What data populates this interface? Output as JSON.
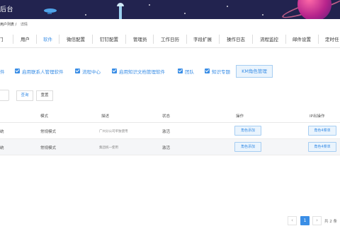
{
  "header": {
    "title": "后台",
    "colors": {
      "banner_bg": "#22234f",
      "accent": "#3a8ee6"
    }
  },
  "breadcrumb": {
    "parent": "用户列表",
    "current": "详情"
  },
  "tabs": [
    {
      "label": "门",
      "active": false
    },
    {
      "label": "用户",
      "active": false
    },
    {
      "label": "软件",
      "active": true
    },
    {
      "label": "微信配置",
      "active": false
    },
    {
      "label": "钉钉配置",
      "active": false
    },
    {
      "label": "管理员",
      "active": false
    },
    {
      "label": "工作日历",
      "active": false
    },
    {
      "label": "字段扩展",
      "active": false
    },
    {
      "label": "操作日志",
      "active": false
    },
    {
      "label": "流程监控",
      "active": false
    },
    {
      "label": "邮件设置",
      "active": false
    },
    {
      "label": "定时任",
      "active": false
    }
  ],
  "permissions": [
    {
      "label": "件",
      "checked": true,
      "show_checkbox": false
    },
    {
      "label": "启用联系人管理软件",
      "checked": true,
      "show_checkbox": true
    },
    {
      "label": "流程中心",
      "checked": true,
      "show_checkbox": true
    },
    {
      "label": "启用知识文档管理软件",
      "checked": true,
      "show_checkbox": true
    },
    {
      "label": "团队",
      "checked": true,
      "show_checkbox": true
    },
    {
      "label": "知识专题",
      "checked": true,
      "show_checkbox": true
    }
  ],
  "km_button": "KM角色管理",
  "search": {
    "query_label": "查询",
    "reset_label": "重置",
    "value": ""
  },
  "table": {
    "headers": [
      "模式",
      "描述",
      "状态",
      "操作",
      "IP出操作"
    ],
    "rows": [
      {
        "name": "统",
        "mode": "常规模式",
        "desc": "广州分公司单独使用",
        "status": "激活",
        "action": "角色添加",
        "action2": "角色4菜单"
      },
      {
        "name": "统",
        "mode": "常规模式",
        "desc": "集团统一使用",
        "status": "激活",
        "action": "角色添加",
        "action2": "角色4菜单"
      }
    ]
  },
  "pagination": {
    "prev": "‹",
    "current": "1",
    "next": "›",
    "total": "共 2 条"
  }
}
